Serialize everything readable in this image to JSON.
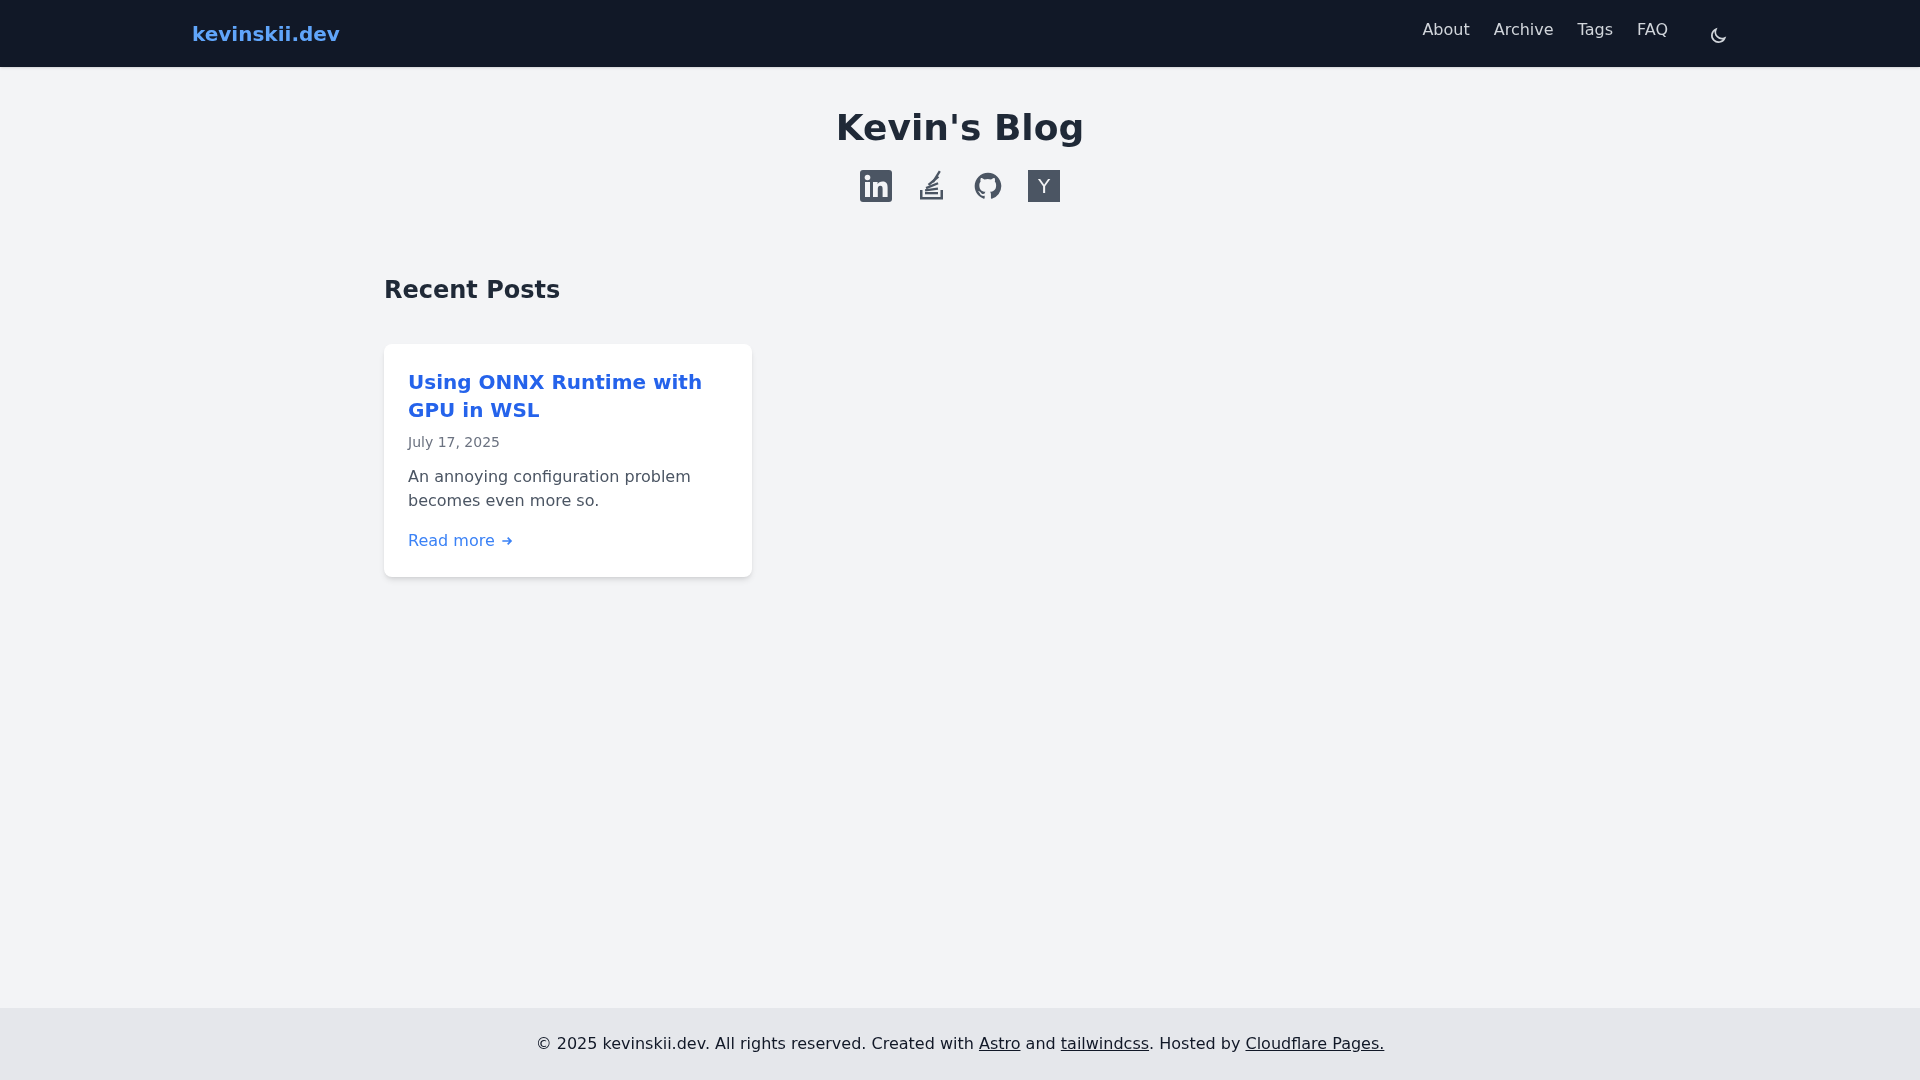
{
  "header": {
    "logo": "kevinskii.dev",
    "nav": [
      "About",
      "Archive",
      "Tags",
      "FAQ"
    ]
  },
  "hero": {
    "title": "Kevin's Blog",
    "social": [
      {
        "kind": "linkedin"
      },
      {
        "kind": "stackoverflow"
      },
      {
        "kind": "github"
      },
      {
        "kind": "hackernews",
        "label": "Y"
      }
    ]
  },
  "recent": {
    "heading": "Recent Posts",
    "posts": [
      {
        "title": "Using ONNX Runtime with GPU in WSL",
        "date": "July 17, 2025",
        "summary": "An annoying configuration problem becomes even more so.",
        "link": "Read more"
      }
    ]
  },
  "footer": {
    "segments": [
      {
        "kind": "text",
        "text": "© 2025 kevinskii.dev. All rights reserved. Created with "
      },
      {
        "kind": "link",
        "text": "Astro"
      },
      {
        "kind": "text",
        "text": " and "
      },
      {
        "kind": "link",
        "text": "tailwindcss"
      },
      {
        "kind": "text",
        "text": ". Hosted by "
      },
      {
        "kind": "link",
        "text": "Cloudflare Pages."
      }
    ]
  }
}
